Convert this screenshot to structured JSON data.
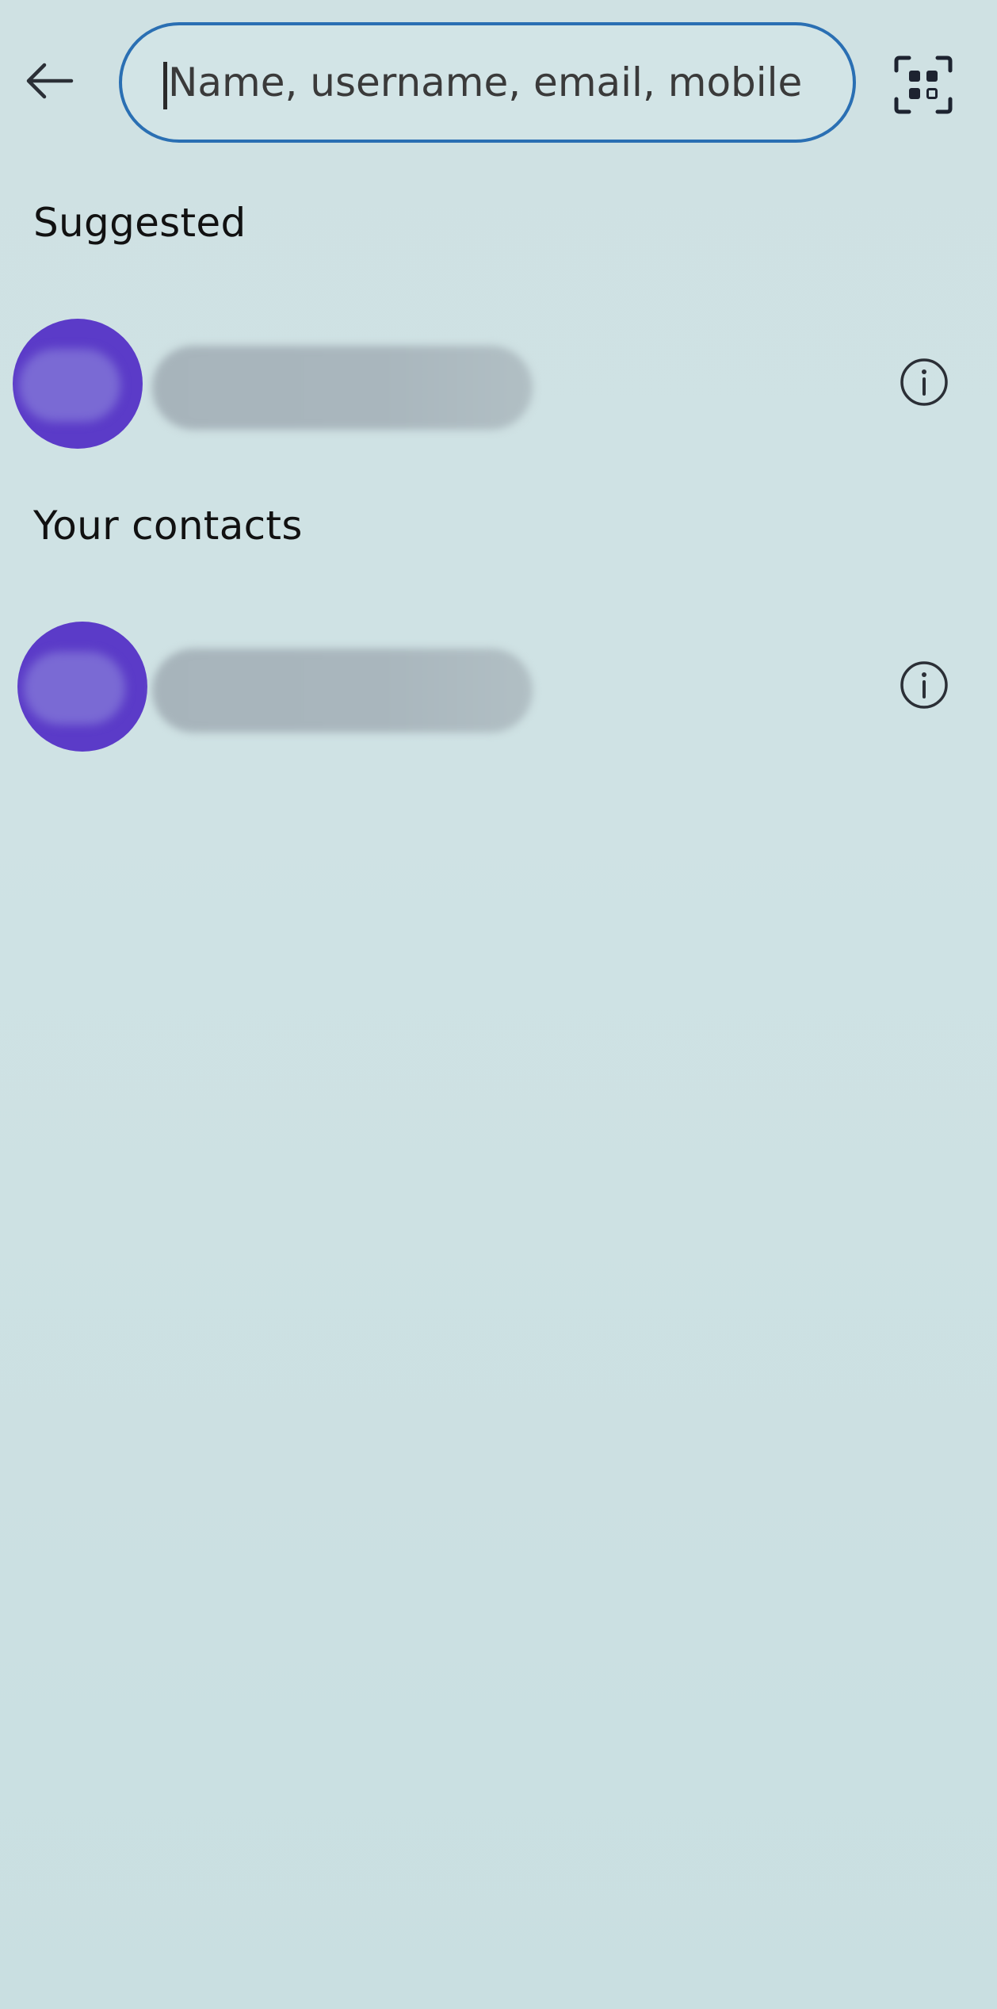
{
  "header": {
    "back_icon": "arrow-left-icon",
    "search": {
      "placeholder": "Name, username, email, mobile",
      "value": ""
    },
    "qr_icon": "qr-scan-icon"
  },
  "sections": [
    {
      "title": "Suggested",
      "contacts": [
        {
          "avatar_icon": "avatar",
          "name_redacted": true,
          "info_icon": "info-icon"
        }
      ]
    },
    {
      "title": "Your contacts",
      "contacts": [
        {
          "avatar_icon": "avatar",
          "name_redacted": true,
          "info_icon": "info-icon"
        }
      ]
    }
  ],
  "colors": {
    "accent": "#2a6fb3",
    "avatar": "#5b3bc8",
    "background": "#cfe2e4",
    "icon": "#2b2f36"
  }
}
